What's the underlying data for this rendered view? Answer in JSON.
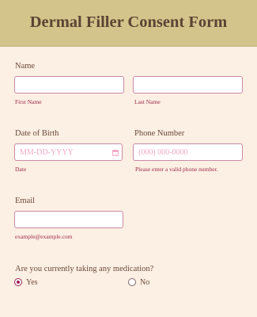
{
  "header": {
    "title": "Dermal Filler Consent Form"
  },
  "name": {
    "label": "Name",
    "first_name_value": "",
    "first_name_sublabel": "First Name",
    "last_name_value": "",
    "last_name_sublabel": "Last Name"
  },
  "dob": {
    "label": "Date of Birth",
    "placeholder": "MM-DD-YYYY",
    "sublabel": "Date",
    "icon": "calendar-icon"
  },
  "phone": {
    "label": "Phone Number",
    "placeholder": "(000) 000-0000",
    "sublabel": "Please enter a valid phone number."
  },
  "email": {
    "label": "Email",
    "value": "",
    "sublabel": "example@example.com"
  },
  "medication": {
    "question": "Are you currently taking any medication?",
    "options": [
      "Yes",
      "No"
    ],
    "selected": "Yes"
  },
  "colors": {
    "header_bg": "#d2c48a",
    "page_bg": "#fcefe3",
    "title_text": "#5b4334",
    "input_border": "#c98aa8",
    "placeholder": "#f3a9c7",
    "sublabel_text": "#9a2a4a",
    "radio_accent": "#a01e55"
  }
}
